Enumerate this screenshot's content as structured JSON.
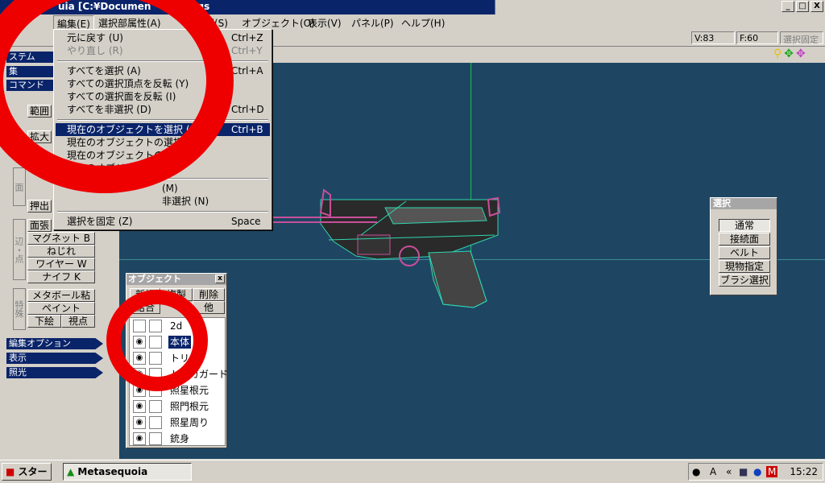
{
  "app": {
    "title": "uia [C:¥Documen",
    "title_tail": "ngs"
  },
  "window_buttons": [
    "_",
    "□",
    "X"
  ],
  "menubar": {
    "items": [
      "編集(E)",
      "選択部属性(A)",
      "理(S)",
      "オブジェクト(O)",
      "表示(V)",
      "パネル(P)",
      "ヘルプ(H)"
    ]
  },
  "status": {
    "vertices": "V:83",
    "faces": "F:60",
    "lock": "選択固定"
  },
  "edit_menu": {
    "items": [
      {
        "label": "元に戻す (U)",
        "shortcut": "Ctrl+Z",
        "disabled": false
      },
      {
        "label": "やり直し (R)",
        "shortcut": "Ctrl+Y",
        "disabled": true
      },
      {
        "label": "すべてを選択 (A)",
        "shortcut": "Ctrl+A"
      },
      {
        "label": "すべての選択頂点を反転 (Y)",
        "shortcut": ""
      },
      {
        "label": "すべての選択面を反転 (I)",
        "shortcut": ""
      },
      {
        "label": "すべてを非選択 (D)",
        "shortcut": "Ctrl+D"
      },
      {
        "label": "現在のオブジェクトを選択 (O)",
        "shortcut": "Ctrl+B"
      },
      {
        "label": "現在のオブジェクトの選択頂点",
        "shortcut": ""
      },
      {
        "label": "現在のオブジェクトの選択面",
        "shortcut": ""
      },
      {
        "label": "現在のオブジェクトを非",
        "shortcut": ""
      },
      {
        "label": "(M)",
        "shortcut": ""
      },
      {
        "label": "非選択 (N)",
        "shortcut": ""
      },
      {
        "label": "選択を固定 (Z)",
        "shortcut": "Space"
      }
    ]
  },
  "left_panel": {
    "headers": [
      "ステム",
      "集",
      "コマンド"
    ],
    "labels": [
      "範囲",
      "拡大",
      "押出",
      "面張"
    ],
    "tools": [
      "マグネット B",
      "ねじれ",
      "ワイヤー W",
      "ナイフ K",
      "メタボール粘土",
      "ペイント",
      "下絵",
      "視点"
    ],
    "section_labels": [
      "面",
      "辺・点",
      "特殊"
    ],
    "bottom_headers": [
      "編集オプション",
      "表示",
      "照光"
    ]
  },
  "object_panel": {
    "title": "オブジェクト",
    "buttons": [
      "新規",
      "複製",
      "削除",
      "結合",
      "他"
    ],
    "objects": [
      {
        "name": "2d",
        "visible": false,
        "selected": false
      },
      {
        "name": "本体",
        "visible": true,
        "selected": true
      },
      {
        "name": "トリガ",
        "visible": true,
        "selected": false
      },
      {
        "name": "トリガガード",
        "visible": true,
        "selected": false
      },
      {
        "name": "照星根元",
        "visible": true,
        "selected": false
      },
      {
        "name": "照門根元",
        "visible": true,
        "selected": false
      },
      {
        "name": "照星周り",
        "visible": true,
        "selected": false
      },
      {
        "name": "銃身",
        "visible": true,
        "selected": false
      }
    ]
  },
  "select_panel": {
    "title": "選択",
    "buttons": [
      "通常",
      "接続面",
      "ベルト",
      "現物指定",
      "ブラシ選択"
    ],
    "active": "通常"
  },
  "taskbar": {
    "start": "スタート",
    "task": "Metasequoia",
    "clock": "15:22",
    "tray_text": "A"
  },
  "colors": {
    "viewport": "#1e4663",
    "highlight": "#0a246a",
    "annotation": "#ee0000"
  }
}
